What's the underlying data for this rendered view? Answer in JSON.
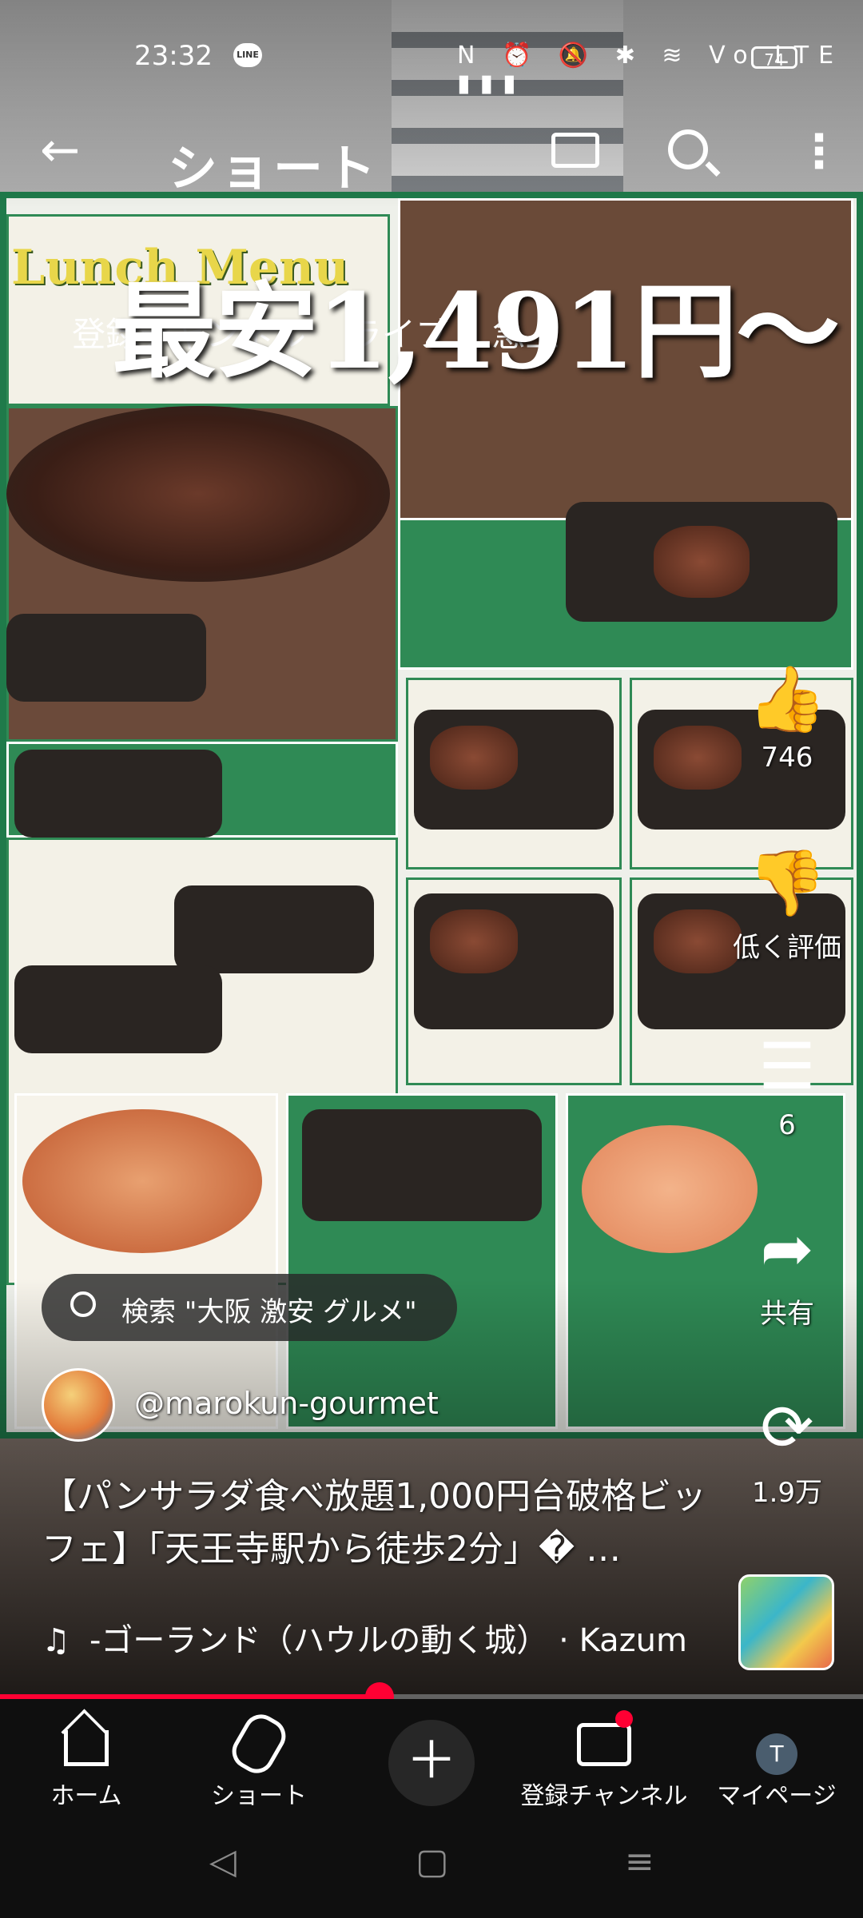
{
  "status_bar": {
    "time": "23:32",
    "line_badge": "LINE",
    "icons": "N ⏰ 🔕 ✱ ≋ Vo LTE ▮▮▮",
    "battery": "74"
  },
  "top_bar": {
    "title": "ショート",
    "back_icon": "arrow-left-icon",
    "cast_icon": "cast-icon",
    "search_icon": "search-icon",
    "more_icon": "more-vertical-icon"
  },
  "chips": [
    "登録チャンネル",
    "ライブ",
    "急上"
  ],
  "video": {
    "overlay_text": "最安1,491円〜",
    "board_title": "Lunch Menu"
  },
  "actions": {
    "like_count": "746",
    "dislike_label": "低く評価",
    "comment_count": "6",
    "share_label": "共有",
    "remix_count": "1.9万"
  },
  "search_suggestion": "検索 \"大阪 激安 グルメ\"",
  "channel": {
    "handle": "@marokun-gourmet"
  },
  "video_title": "【パンサラダ食べ放題1,000円台破格ビッフェ】「天王寺駅から徒歩2分」� …",
  "music": "-ゴーランド（ハウルの動く城） · Kazum",
  "progress_fraction": 0.44,
  "bottom_nav": {
    "home": "ホーム",
    "shorts": "ショート",
    "subscriptions": "登録チャンネル",
    "you": "マイページ",
    "you_initial": "T"
  },
  "colors": {
    "accent": "#ff0033",
    "board_green": "#2f8a55"
  }
}
